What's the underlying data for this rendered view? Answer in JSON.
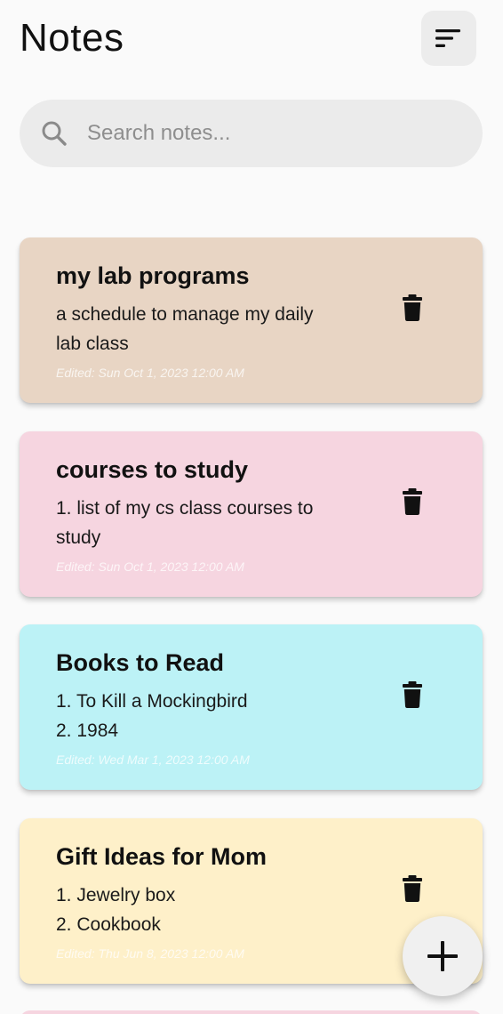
{
  "header": {
    "title": "Notes",
    "sort_icon": "sort-lines-icon"
  },
  "search": {
    "placeholder": "Search notes...",
    "icon": "search-icon"
  },
  "notes": [
    {
      "title": "my lab programs",
      "body": "a schedule to manage my daily\nlab class",
      "edited": "Edited: Sun Oct 1, 2023 12:00 AM",
      "color": "#e8d5c4"
    },
    {
      "title": "courses to study",
      "body": "1. list of my cs class courses to\nstudy",
      "edited": "Edited: Sun Oct 1, 2023 12:00 AM",
      "color": "#f6d5e0"
    },
    {
      "title": "Books to Read",
      "body": "1. To Kill a Mockingbird\n2. 1984",
      "edited": "Edited: Wed Mar 1, 2023 12:00 AM",
      "color": "#bcf2f6"
    },
    {
      "title": "Gift Ideas for Mom",
      "body": "1. Jewelry box\n2. Cookbook",
      "edited": "Edited: Thu Jun 8, 2023 12:00 AM",
      "color": "#fef0c9"
    }
  ],
  "next_note_color": "#f6d5e0",
  "fab": {
    "icon": "plus-icon"
  },
  "colors": {
    "background": "#fafafa",
    "search_bg": "#ebebeb",
    "sort_btn_bg": "#ececec"
  }
}
